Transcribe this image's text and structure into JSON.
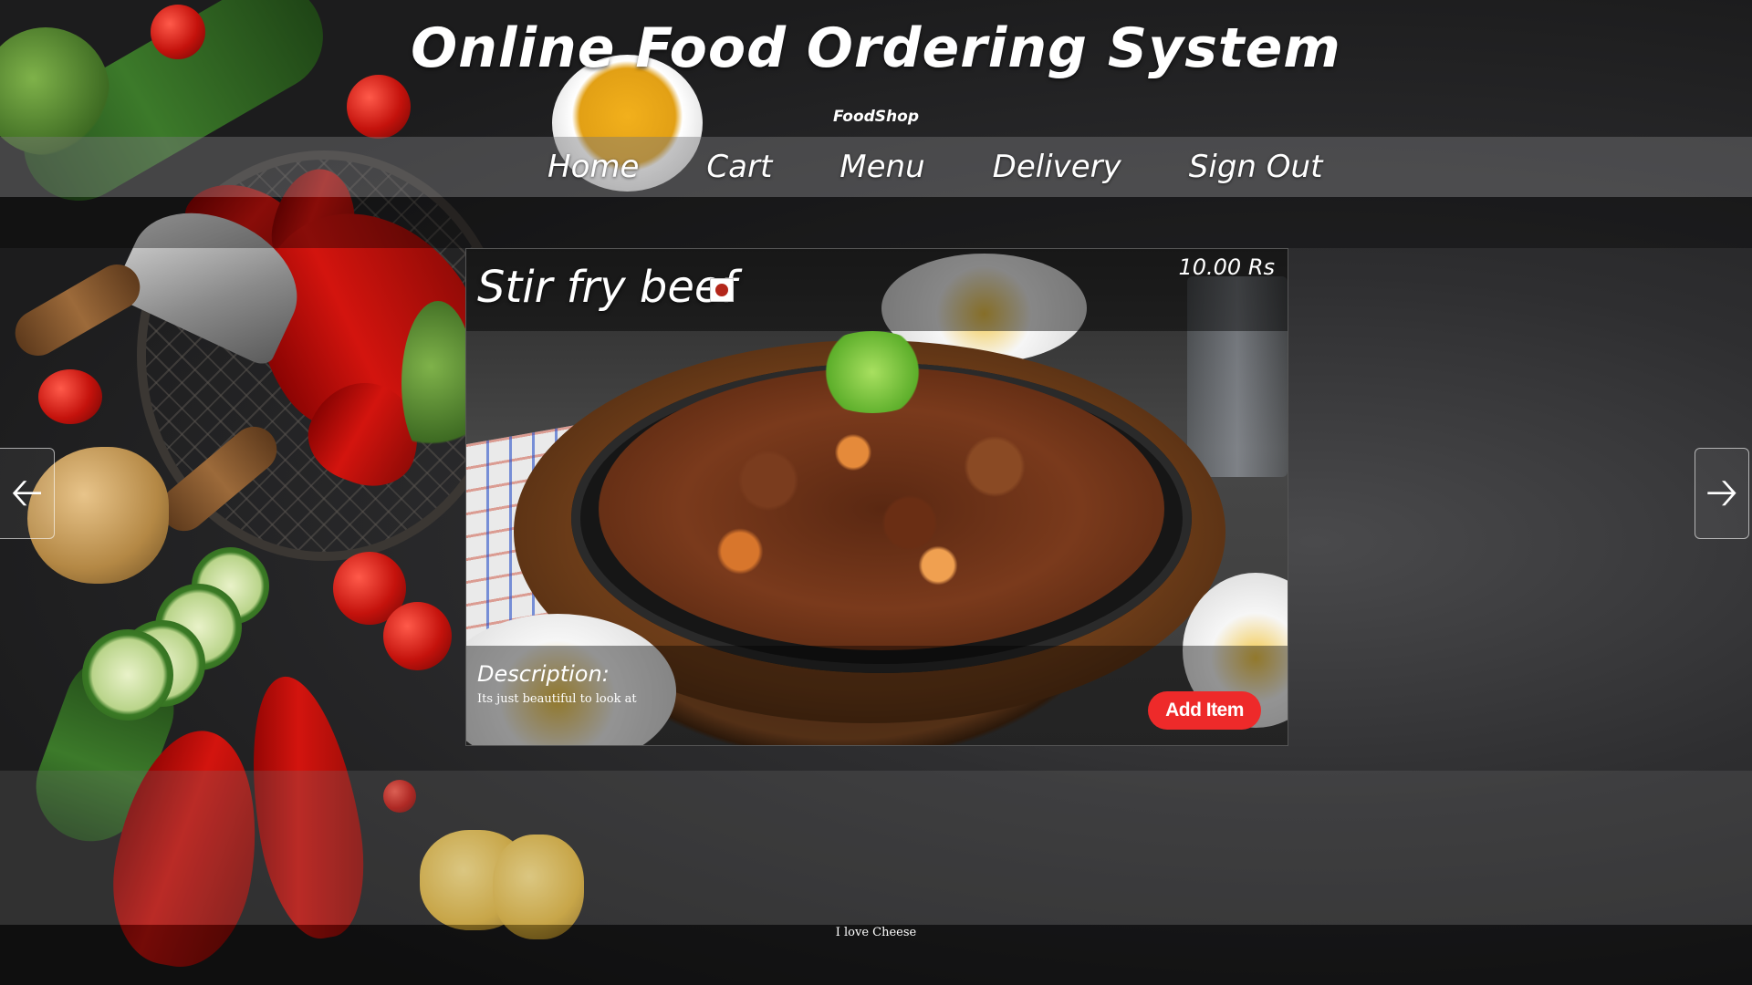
{
  "header": {
    "title": "Online Food Ordering System",
    "subtitle": "FoodShop"
  },
  "nav": {
    "items": [
      {
        "label": "Home"
      },
      {
        "label": "Cart"
      },
      {
        "label": "Menu"
      },
      {
        "label": "Delivery"
      },
      {
        "label": "Sign Out"
      }
    ]
  },
  "item": {
    "name": "Stir fry beef",
    "price": "10.00 Rs",
    "description_label": "Description:",
    "description": "Its just beautiful to look at",
    "add_label": "Add Item",
    "veg_indicator_icon": "non-veg-indicator-icon"
  },
  "slider": {
    "prev_icon": "arrow-left-icon",
    "next_icon": "arrow-right-icon",
    "prev_glyph": "🡠",
    "next_glyph": "🡢"
  },
  "footer": {
    "text": "I love Cheese"
  },
  "colors": {
    "accent": "#ee2a2a",
    "nav_bar": "#78787a",
    "veg_mark": "#b3261a"
  }
}
